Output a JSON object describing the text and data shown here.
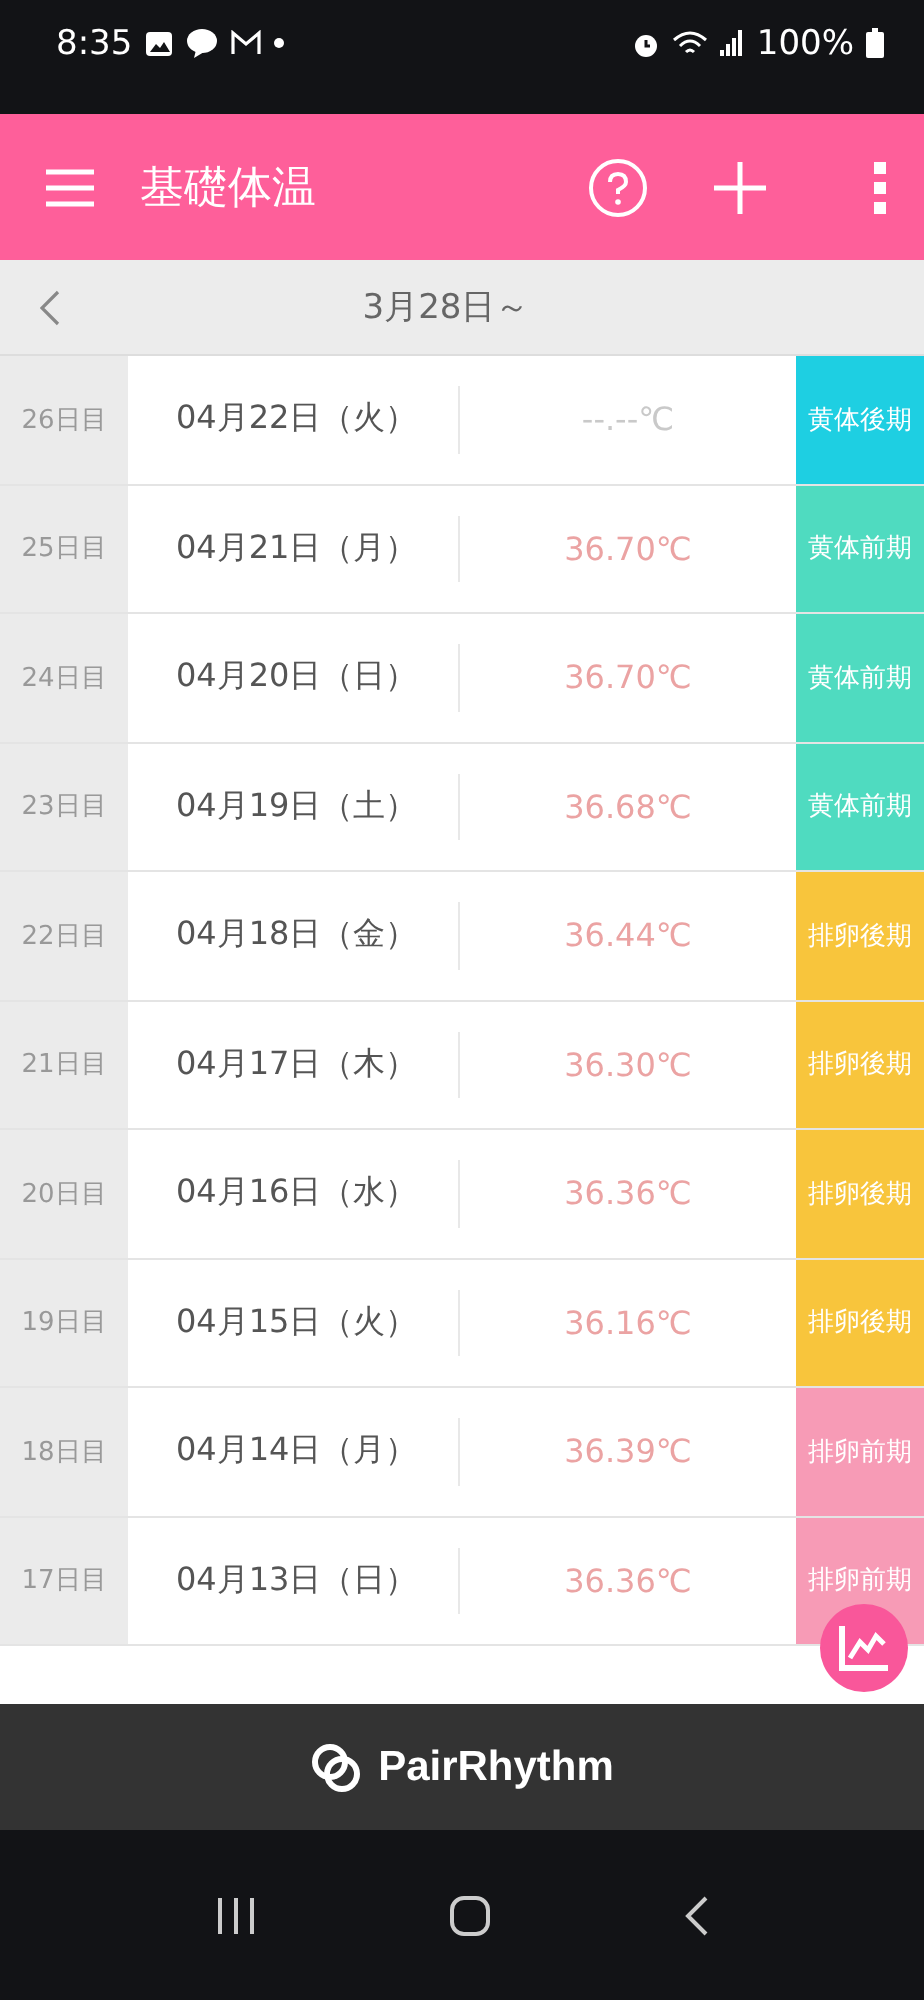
{
  "status_bar": {
    "time": "8:35",
    "battery": "100%"
  },
  "header": {
    "title": "基礎体温"
  },
  "period_bar": {
    "label": "3月28日～"
  },
  "rows": [
    {
      "day": "26日目",
      "date": "04月22日（火）",
      "temp": "--.--℃",
      "recorded": false,
      "phase": "黄体後期",
      "color": "#1ecfe2"
    },
    {
      "day": "25日目",
      "date": "04月21日（月）",
      "temp": "36.70℃",
      "recorded": true,
      "phase": "黄体前期",
      "color": "#4fdbc0"
    },
    {
      "day": "24日目",
      "date": "04月20日（日）",
      "temp": "36.70℃",
      "recorded": true,
      "phase": "黄体前期",
      "color": "#4fdbc0"
    },
    {
      "day": "23日目",
      "date": "04月19日（土）",
      "temp": "36.68℃",
      "recorded": true,
      "phase": "黄体前期",
      "color": "#4fdbc0"
    },
    {
      "day": "22日目",
      "date": "04月18日（金）",
      "temp": "36.44℃",
      "recorded": true,
      "phase": "排卵後期",
      "color": "#f8c53c"
    },
    {
      "day": "21日目",
      "date": "04月17日（木）",
      "temp": "36.30℃",
      "recorded": true,
      "phase": "排卵後期",
      "color": "#f8c53c"
    },
    {
      "day": "20日目",
      "date": "04月16日（水）",
      "temp": "36.36℃",
      "recorded": true,
      "phase": "排卵後期",
      "color": "#f8c53c"
    },
    {
      "day": "19日目",
      "date": "04月15日（火）",
      "temp": "36.16℃",
      "recorded": true,
      "phase": "排卵後期",
      "color": "#f8c53c"
    },
    {
      "day": "18日目",
      "date": "04月14日（月）",
      "temp": "36.39℃",
      "recorded": true,
      "phase": "排卵前期",
      "color": "#f79bb6"
    },
    {
      "day": "17日目",
      "date": "04月13日（日）",
      "temp": "36.36℃",
      "recorded": true,
      "phase": "排卵前期",
      "color": "#f79bb6"
    }
  ],
  "brand": {
    "name": "PairRhythm"
  }
}
